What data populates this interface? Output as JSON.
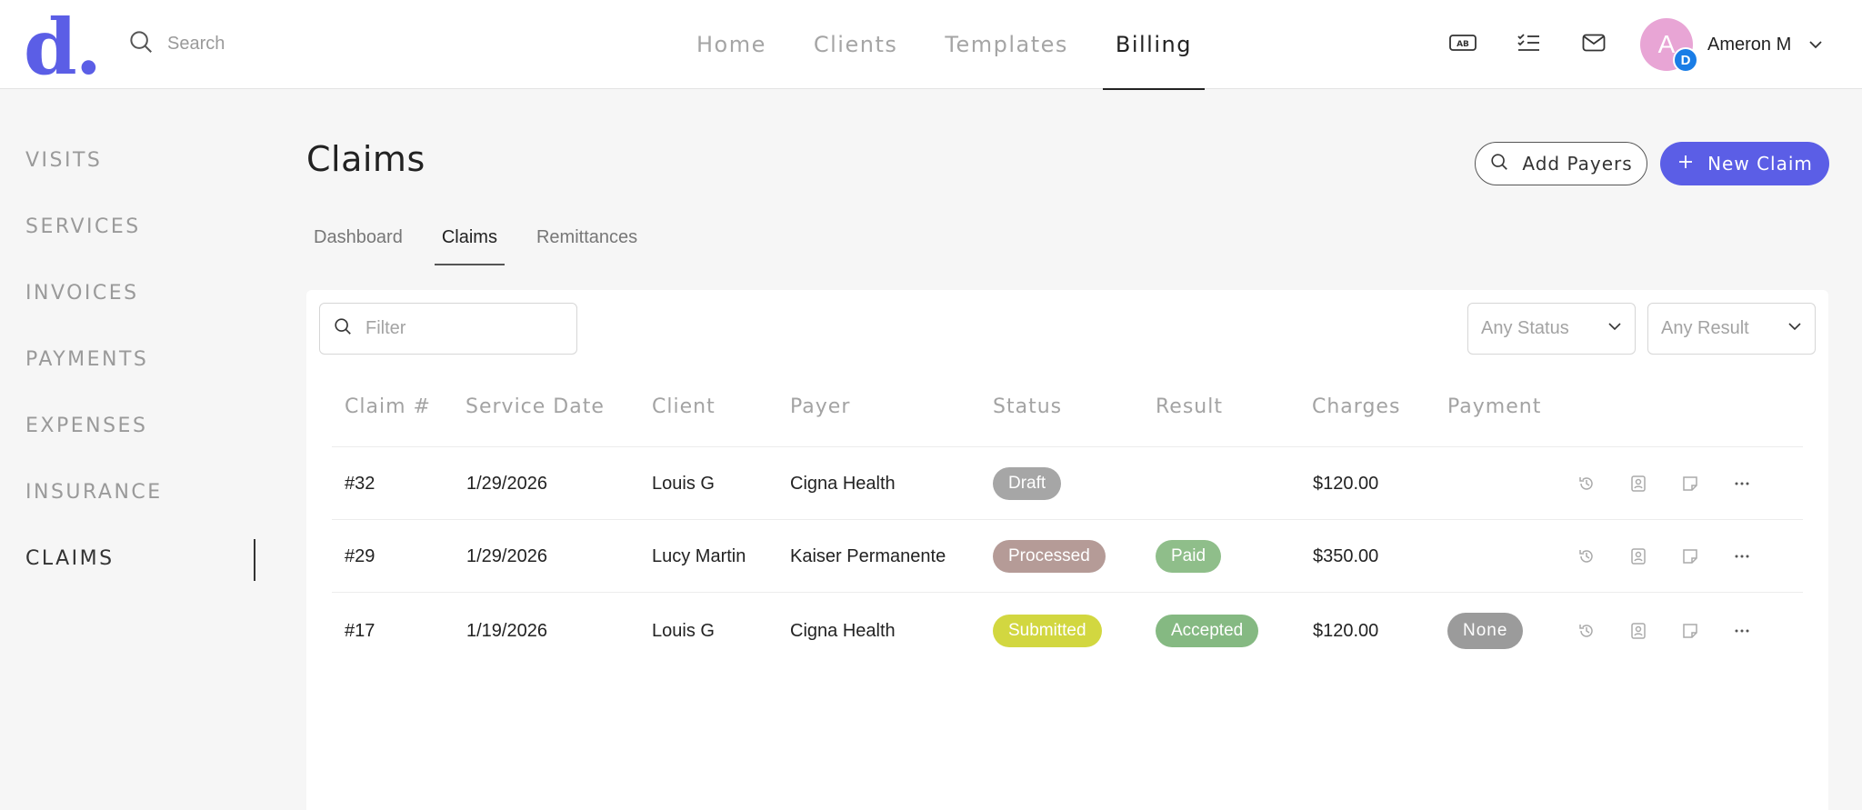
{
  "brand": {
    "logo_letter": "d",
    "logo_dot": ".",
    "accent": "#5b5ee6"
  },
  "search": {
    "placeholder": "Search"
  },
  "topnav": [
    {
      "label": "Home"
    },
    {
      "label": "Clients"
    },
    {
      "label": "Templates"
    },
    {
      "label": "Billing",
      "active": true
    }
  ],
  "header_icons": [
    "ab-icon",
    "checklist-icon",
    "mail-icon"
  ],
  "user": {
    "initial": "A",
    "badge": "D",
    "name": "Ameron M"
  },
  "sidebar": {
    "items": [
      {
        "label": "VISITS"
      },
      {
        "label": "SERVICES"
      },
      {
        "label": "INVOICES"
      },
      {
        "label": "PAYMENTS"
      },
      {
        "label": "EXPENSES"
      },
      {
        "label": "INSURANCE"
      },
      {
        "label": "CLAIMS",
        "active": true
      }
    ]
  },
  "page": {
    "title": "Claims",
    "add_payers_label": "Add Payers",
    "new_claim_label": "New Claim"
  },
  "subtabs": [
    {
      "label": "Dashboard"
    },
    {
      "label": "Claims",
      "active": true
    },
    {
      "label": "Remittances"
    }
  ],
  "filters": {
    "filter_placeholder": "Filter",
    "status_value": "Any Status",
    "result_value": "Any Result"
  },
  "table": {
    "headers": [
      "Claim #",
      "Service Date",
      "Client",
      "Payer",
      "Status",
      "Result",
      "Charges",
      "Payment"
    ],
    "rows": [
      {
        "claim": "#32",
        "date": "1/29/2026",
        "client": "Louis G",
        "payer": "Cigna Health",
        "status": "Draft",
        "status_color": "#a6a6a6",
        "result": "",
        "result_color": "",
        "charges": "$120.00",
        "payment": "",
        "payment_color": ""
      },
      {
        "claim": "#29",
        "date": "1/29/2026",
        "client": "Lucy Martin",
        "payer": "Kaiser Permanente",
        "status": "Processed",
        "status_color": "#b59b97",
        "result": "Paid",
        "result_color": "#8fbe8a",
        "charges": "$350.00",
        "payment": "",
        "payment_color": ""
      },
      {
        "claim": "#17",
        "date": "1/19/2026",
        "client": "Louis G",
        "payer": "Cigna Health",
        "status": "Submitted",
        "status_color": "#d2d740",
        "result": "Accepted",
        "result_color": "#85b982",
        "charges": "$120.00",
        "payment": "None",
        "payment_color": "#9b9b9b"
      }
    ]
  }
}
